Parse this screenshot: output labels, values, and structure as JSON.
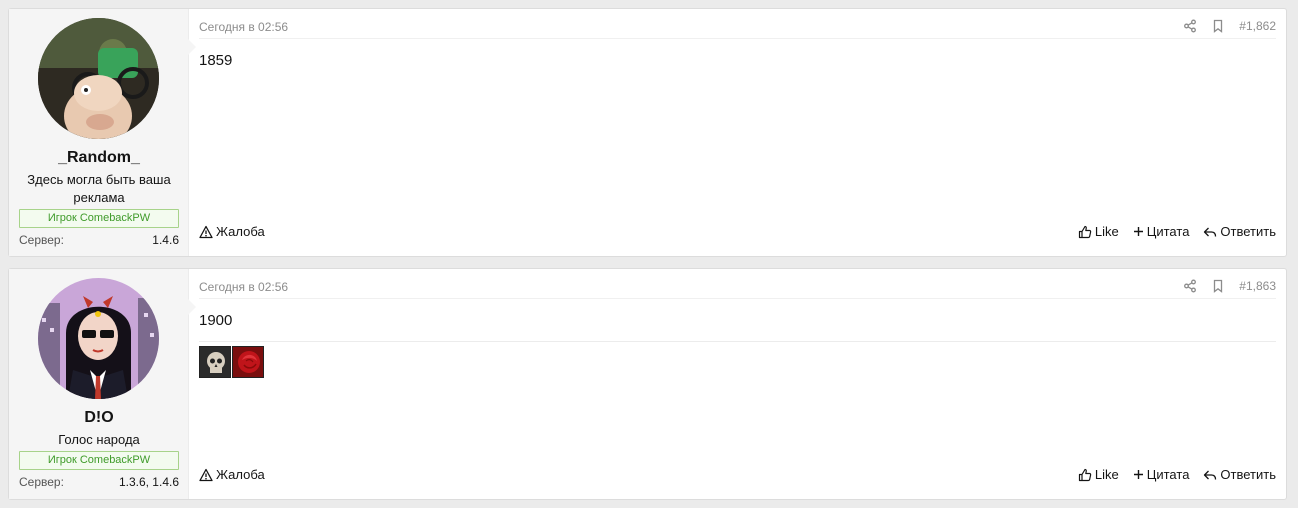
{
  "posts": [
    {
      "user": {
        "name": "_Random_",
        "title": "Здесь могла быть ваша реклама",
        "banner": "Игрок ComebackPW",
        "server_label": "Сервер:",
        "server_value": "1.4.6"
      },
      "date": "Сегодня в 02:56",
      "number": "#1,862",
      "content": "1859",
      "report": "Жалоба",
      "like": "Like",
      "quote": "Цитата",
      "reply": "Ответить"
    },
    {
      "user": {
        "name": "D!O",
        "title": "Голос народа",
        "banner": "Игрок ComebackPW",
        "server_label": "Сервер:",
        "server_value": "1.3.6, 1.4.6"
      },
      "date": "Сегодня в 02:56",
      "number": "#1,863",
      "content": "1900",
      "report": "Жалоба",
      "like": "Like",
      "quote": "Цитата",
      "reply": "Ответить"
    }
  ],
  "icons": {
    "share": "share-icon",
    "bookmark": "bookmark-icon",
    "report": "warning-icon",
    "like": "thumbs-up-icon",
    "quote": "plus-icon",
    "reply": "reply-icon"
  },
  "colors": {
    "banner_border": "#a7d38a",
    "banner_text": "#3f9b2a",
    "meta_text": "#8c8c8c"
  }
}
